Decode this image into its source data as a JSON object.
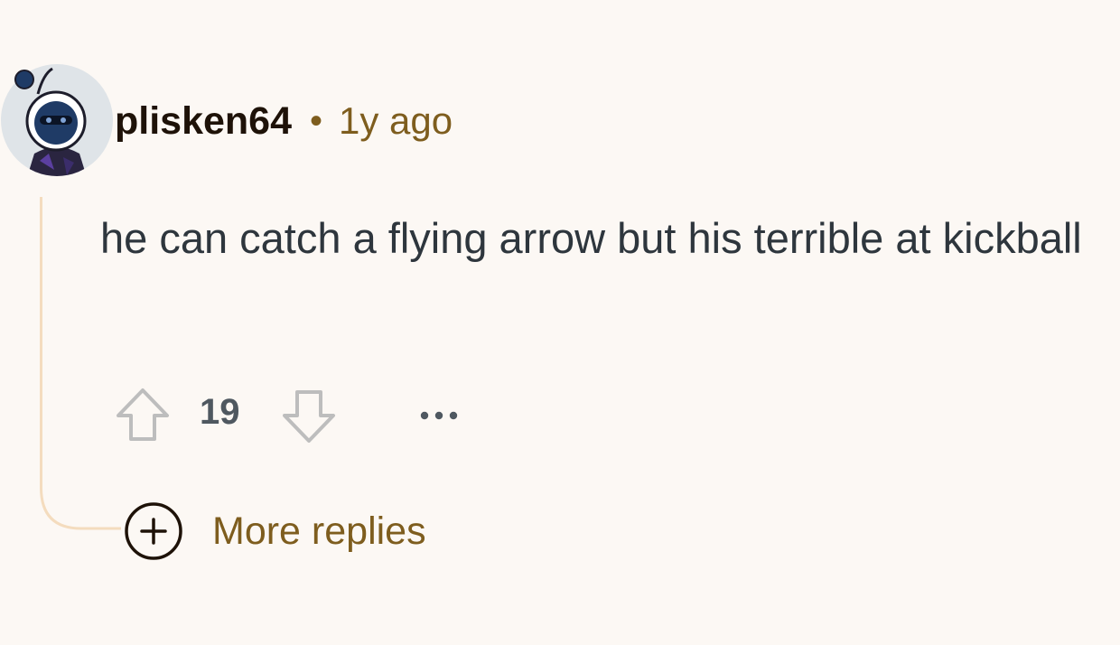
{
  "comment": {
    "username": "plisken64",
    "separator": "•",
    "timestamp": "1y ago",
    "body": "he can catch a flying arrow but his terrible at kickball",
    "vote_count": "19",
    "upvote_icon": "arrow-up-outline-icon",
    "downvote_icon": "arrow-down-outline-icon",
    "more_icon": "ellipsis-horizontal-icon"
  },
  "more_replies": {
    "label": "More replies",
    "icon": "plus-circle-icon"
  },
  "colors": {
    "background": "#fcf8f4",
    "username": "#1e1208",
    "meta": "#7e5d1e",
    "body": "#2e363d",
    "thread_line": "#f4dcbe",
    "vote_icon": "#bdbdbd"
  }
}
